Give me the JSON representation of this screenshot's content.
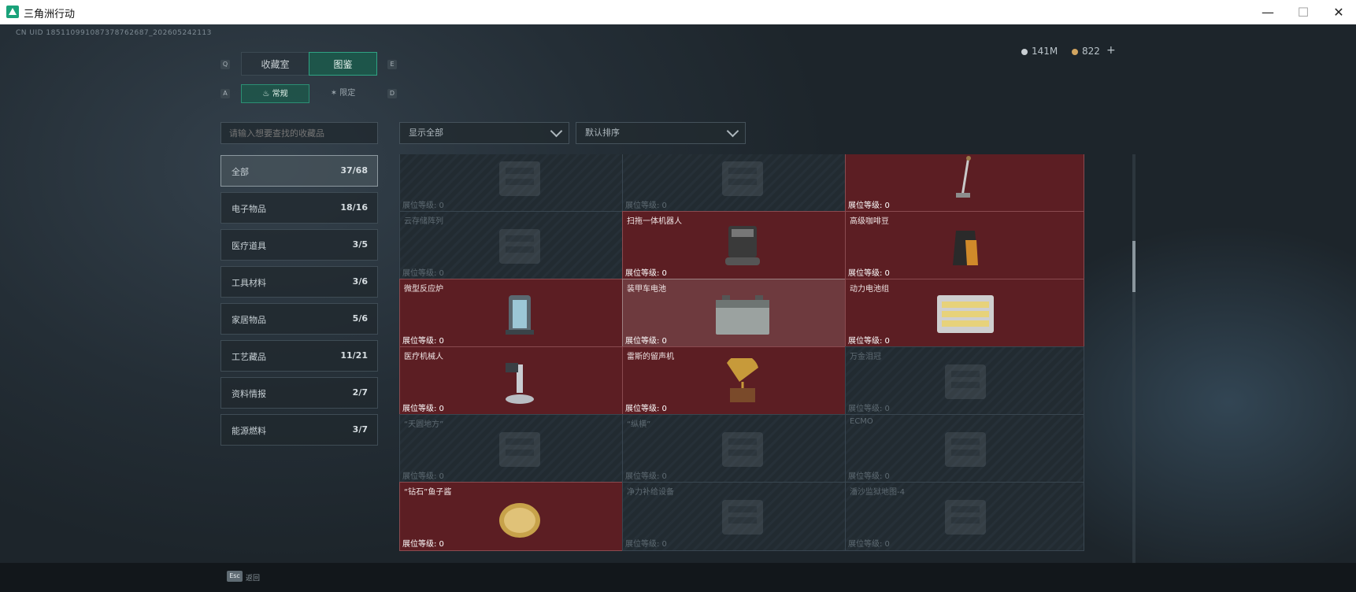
{
  "window": {
    "title": "三角洲行动",
    "minimize": "—",
    "maximize": "☐",
    "close": "✕"
  },
  "header": {
    "uid": "CN UID 18511099108737876268​7_202605242113",
    "currency": [
      {
        "icon": "silver-coin-icon",
        "value": "141M"
      },
      {
        "icon": "gold-coin-icon",
        "value": "822"
      }
    ],
    "add_label": "+"
  },
  "tabs": {
    "left_key": "Q",
    "right_key": "E",
    "items": [
      {
        "label": "收藏室",
        "active": false
      },
      {
        "label": "图鉴",
        "active": true
      }
    ]
  },
  "subtabs": {
    "left_key": "A",
    "right_key": "D",
    "items": [
      {
        "label": "常规",
        "active": true
      },
      {
        "label": "限定",
        "active": false
      }
    ]
  },
  "search": {
    "placeholder": "请输入想要查找的收藏品"
  },
  "filters": {
    "show": "显示全部",
    "sort": "默认排序"
  },
  "categories": [
    {
      "label": "全部",
      "count": "37/68",
      "active": true
    },
    {
      "label": "电子物品",
      "count": "18/16"
    },
    {
      "label": "医疗道具",
      "count": "3/5"
    },
    {
      "label": "工具材料",
      "count": "3/6"
    },
    {
      "label": "家居物品",
      "count": "5/6"
    },
    {
      "label": "工艺藏品",
      "count": "11/21"
    },
    {
      "label": "资料情报",
      "count": "2/7"
    },
    {
      "label": "能源燃料",
      "count": "3/7"
    }
  ],
  "level_label": "展位等级: 0",
  "items": [
    {
      "name": "",
      "owned": false,
      "icon": "crate-icon"
    },
    {
      "name": "",
      "owned": false,
      "icon": "machine-icon"
    },
    {
      "name": "",
      "owned": true,
      "icon": "vacuum-icon"
    },
    {
      "name": "云存储阵列",
      "owned": false,
      "icon": "server-array-icon"
    },
    {
      "name": "扫拖一体机器人",
      "owned": true,
      "icon": "robot-vacuum-icon",
      "new": true
    },
    {
      "name": "高级咖啡豆",
      "owned": true,
      "icon": "coffee-bag-icon"
    },
    {
      "name": "微型反应炉",
      "owned": true,
      "icon": "reactor-icon"
    },
    {
      "name": "装甲车电池",
      "owned": true,
      "selected": true,
      "icon": "car-battery-icon"
    },
    {
      "name": "动力电池组",
      "owned": true,
      "icon": "battery-pack-icon"
    },
    {
      "name": "医疗机械人",
      "owned": true,
      "icon": "medical-robot-icon",
      "new": true
    },
    {
      "name": "雷斯的留声机",
      "owned": true,
      "icon": "gramophone-icon"
    },
    {
      "name": "万金泪冠",
      "owned": false,
      "icon": "crown-icon"
    },
    {
      "name": "“天圆地方”",
      "owned": false,
      "icon": "artifact-icon"
    },
    {
      "name": "“纵横”",
      "owned": false,
      "icon": "board-icon"
    },
    {
      "name": "ECMO",
      "owned": false,
      "icon": "ecmo-icon"
    },
    {
      "name": "“钻石”鱼子酱",
      "owned": true,
      "icon": "caviar-icon"
    },
    {
      "name": "净力补给设备",
      "owned": false,
      "icon": "device-icon"
    },
    {
      "name": "潘沙监狱地图-4",
      "owned": false,
      "icon": "map-icon"
    }
  ],
  "footer": {
    "key": "Esc",
    "label": "返回"
  }
}
